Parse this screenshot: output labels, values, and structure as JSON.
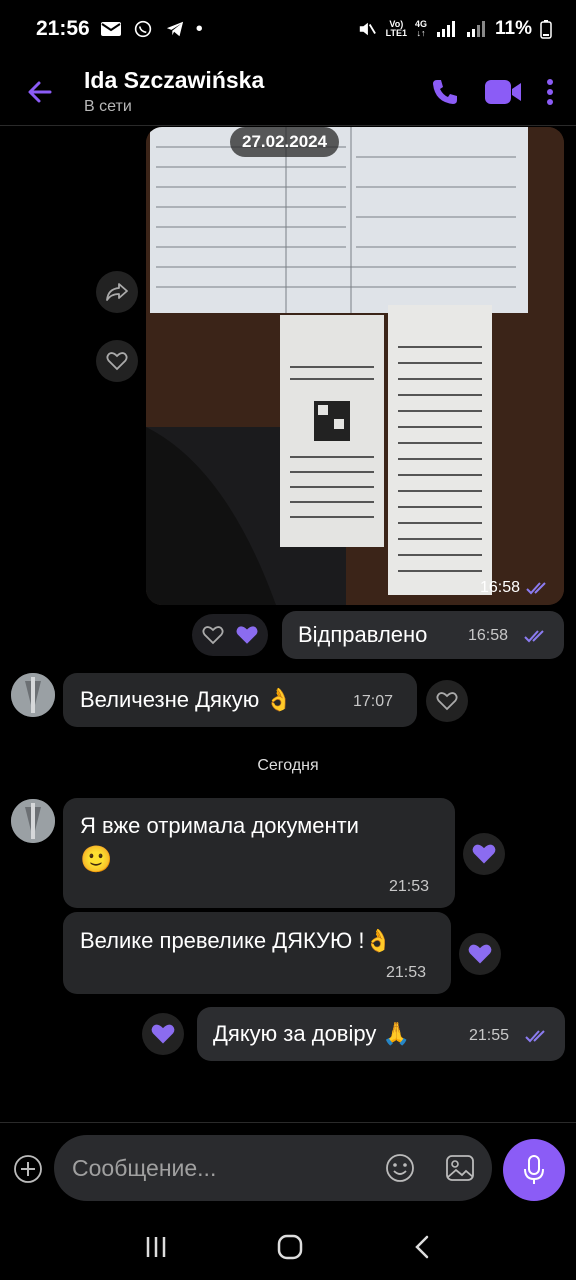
{
  "status_bar": {
    "time": "21:56",
    "dot": "•",
    "net_top": "Vo)",
    "net_bottom": "LTE1",
    "gen_top": "4G",
    "battery": "11%"
  },
  "header": {
    "name": "Ida Szczawińska",
    "status": "В сети"
  },
  "chat": {
    "date_chip": "27.02.2024",
    "photo_time": "16:58",
    "messages": [
      {
        "text": "Відправлено",
        "time": "16:58"
      },
      {
        "text": "Величезне Дякую 👌",
        "time": "17:07"
      },
      {
        "text": "Я вже отримала документи",
        "emoji": "🙂",
        "time": "21:53"
      },
      {
        "text": "Велике превелике ДЯКУЮ !👌",
        "time": "21:53"
      },
      {
        "text": "Дякую за довіру 🙏",
        "time": "21:55"
      }
    ],
    "day_separator": "Сегодня"
  },
  "composer": {
    "placeholder": "Сообщение..."
  },
  "colors": {
    "accent": "#8b5cf6",
    "bubble": "#262729",
    "background": "#000000",
    "tick": "#8b7bf0"
  },
  "icons": [
    "back-arrow-icon",
    "phone-icon",
    "video-icon",
    "more-icon",
    "share-icon",
    "heart-icon",
    "plus-icon",
    "sticker-icon",
    "gallery-icon",
    "mic-icon"
  ]
}
